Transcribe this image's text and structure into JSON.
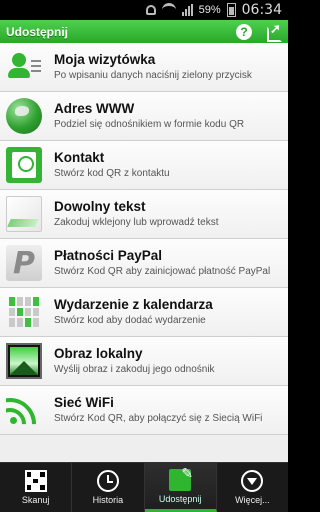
{
  "status_bar": {
    "battery": "59%",
    "time": "06:34"
  },
  "action_bar": {
    "title": "Udostępnij",
    "help_glyph": "?"
  },
  "items": [
    {
      "title": "Moja wizytówka",
      "subtitle": "Po wpisaniu danych naciśnij zielony przycisk",
      "icon": "business-card-icon"
    },
    {
      "title": "Adres WWW",
      "subtitle": "Podziel się odnośnikiem w formie kodu QR",
      "icon": "globe-icon"
    },
    {
      "title": "Kontakt",
      "subtitle": "Stwórz kod QR z kontaktu",
      "icon": "contact-icon"
    },
    {
      "title": "Dowolny tekst",
      "subtitle": "Zakoduj wklejony lub wprowadź tekst",
      "icon": "note-icon"
    },
    {
      "title": "Płatności PayPal",
      "subtitle": "Stwórz Kod QR aby zainicjować płatność PayPal",
      "icon": "paypal-icon",
      "paypal_glyph": "P"
    },
    {
      "title": "Wydarzenie z kalendarza",
      "subtitle": "Stwórz kod aby dodać wydarzenie",
      "icon": "calendar-icon"
    },
    {
      "title": "Obraz lokalny",
      "subtitle": "Wyślij obraz i zakoduj jego odnośnik",
      "icon": "image-icon"
    },
    {
      "title": "Sieć WiFi",
      "subtitle": "Stwórz Kod QR, aby połączyć się z Siecią WiFi",
      "icon": "wifi-icon"
    }
  ],
  "tabs": [
    {
      "label": "Skanuj",
      "icon": "qr-code-icon"
    },
    {
      "label": "Historia",
      "icon": "clock-icon"
    },
    {
      "label": "Udostępnij",
      "icon": "share-qr-icon",
      "active": true
    },
    {
      "label": "Więcej...",
      "icon": "more-icon"
    }
  ],
  "colors": {
    "accent": "#2fb52f",
    "action_bar": "#3cbc3c",
    "tab_bar": "#1a1a1a"
  }
}
